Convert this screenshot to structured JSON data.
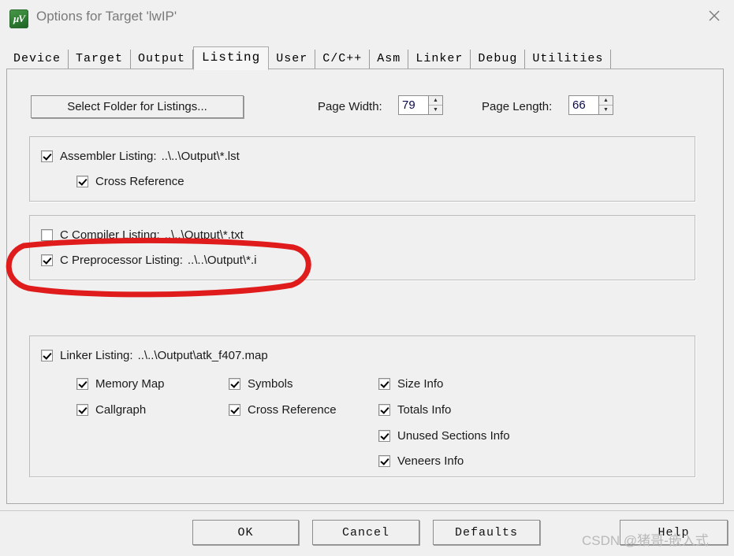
{
  "window": {
    "title": "Options for Target 'lwIP'",
    "icon": "uvision-logo-icon",
    "close_label": "×"
  },
  "tabs": [
    {
      "label": "Device",
      "selected": false
    },
    {
      "label": "Target",
      "selected": false
    },
    {
      "label": "Output",
      "selected": false
    },
    {
      "label": "Listing",
      "selected": true
    },
    {
      "label": "User",
      "selected": false
    },
    {
      "label": "C/C++",
      "selected": false
    },
    {
      "label": "Asm",
      "selected": false
    },
    {
      "label": "Linker",
      "selected": false
    },
    {
      "label": "Debug",
      "selected": false
    },
    {
      "label": "Utilities",
      "selected": false
    }
  ],
  "toolbar": {
    "select_folder_label": "Select Folder for Listings...",
    "page_width_label": "Page Width:",
    "page_width_value": "79",
    "page_length_label": "Page Length:",
    "page_length_value": "66",
    "spin_up": "▲",
    "spin_down": "▼"
  },
  "assembler_group": {
    "assembler_listing": {
      "label": "Assembler Listing:",
      "path": "..\\..\\Output\\*.lst",
      "checked": true
    },
    "cross_reference": {
      "label": "Cross Reference",
      "checked": true
    }
  },
  "compiler_group": {
    "c_compiler_listing": {
      "label": "C Compiler Listing:",
      "path": "..\\..\\Output\\*.txt",
      "checked": false
    },
    "c_preprocessor_listing": {
      "label": "C Preprocessor Listing:",
      "path": "..\\..\\Output\\*.i",
      "checked": true
    }
  },
  "linker_group": {
    "linker_listing": {
      "label": "Linker Listing:",
      "path": "..\\..\\Output\\atk_f407.map",
      "checked": true
    },
    "column1": [
      {
        "label": "Memory Map",
        "checked": true
      },
      {
        "label": "Callgraph",
        "checked": true
      }
    ],
    "column2": [
      {
        "label": "Symbols",
        "checked": true
      },
      {
        "label": "Cross Reference",
        "checked": true
      }
    ],
    "column3": [
      {
        "label": "Size Info",
        "checked": true
      },
      {
        "label": "Totals Info",
        "checked": true
      },
      {
        "label": "Unused Sections Info",
        "checked": true
      },
      {
        "label": "Veneers Info",
        "checked": true
      }
    ]
  },
  "buttons": {
    "ok": "OK",
    "cancel": "Cancel",
    "defaults": "Defaults",
    "help": "Help"
  },
  "annotation": {
    "color": "#e01b1b",
    "shape": "red-ellipse-highlight"
  },
  "watermark": {
    "text": "CSDN @猪哥-嵌入式"
  }
}
